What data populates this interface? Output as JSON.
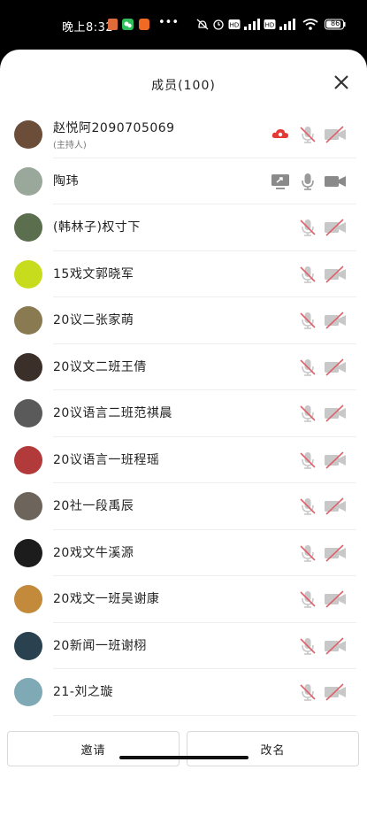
{
  "status_bar": {
    "time": "晚上8:32",
    "battery": "86",
    "more": "•••"
  },
  "header": {
    "title": "成员(100)"
  },
  "colors": {
    "muted_icon": "#c8c8c8",
    "slash": "#e0606a",
    "accent": "#e53935"
  },
  "members": [
    {
      "name": "赵悦阿2090705069",
      "sub": "(主持人)",
      "mic": "muted",
      "cam": "off",
      "extra": "cloud-icon",
      "avatar": "#6b4d3a"
    },
    {
      "name": "陶玮",
      "mic": "on",
      "cam": "on",
      "extra": "screen-share-icon",
      "avatar": "#9aa89b"
    },
    {
      "name": "(韩林子)权寸下",
      "mic": "muted",
      "cam": "off",
      "avatar": "#5b6e4e"
    },
    {
      "name": "15戏文郭晓军",
      "mic": "muted",
      "cam": "off",
      "avatar": "#c8dc1e"
    },
    {
      "name": "20议二张家萌",
      "mic": "muted",
      "cam": "off",
      "avatar": "#8a7a52"
    },
    {
      "name": "20议文二班王倩",
      "mic": "muted",
      "cam": "off",
      "avatar": "#3a2f29"
    },
    {
      "name": "20议语言二班范祺晨",
      "mic": "muted",
      "cam": "off",
      "avatar": "#5a5a5a"
    },
    {
      "name": "20议语言一班程瑶",
      "mic": "muted",
      "cam": "off",
      "avatar": "#b23a3a"
    },
    {
      "name": "20社一段禹辰",
      "mic": "muted",
      "cam": "off",
      "avatar": "#6d645c"
    },
    {
      "name": "20戏文牛溪源",
      "mic": "muted",
      "cam": "off",
      "avatar": "#1c1c1c"
    },
    {
      "name": "20戏文一班吴谢康",
      "mic": "muted",
      "cam": "off",
      "avatar": "#c48a3c"
    },
    {
      "name": "20新闻一班谢栩",
      "mic": "muted",
      "cam": "off",
      "avatar": "#2a4250"
    },
    {
      "name": "21-刘之璇",
      "mic": "muted",
      "cam": "off",
      "avatar": "#7fa9b5"
    }
  ],
  "footer": {
    "invite_label": "邀请",
    "rename_label": "改名"
  }
}
